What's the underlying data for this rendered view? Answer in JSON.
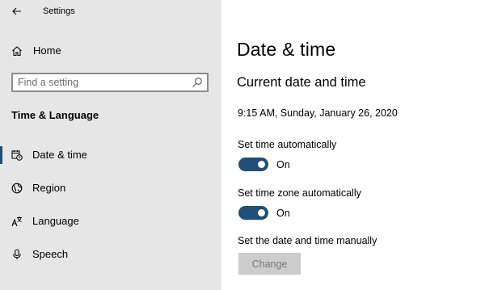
{
  "window": {
    "title": "Settings"
  },
  "sidebar": {
    "home_label": "Home",
    "search": {
      "placeholder": "Find a setting",
      "value": ""
    },
    "section_title": "Time & Language",
    "items": [
      {
        "label": "Date & time",
        "icon": "calendar-clock-icon",
        "selected": true
      },
      {
        "label": "Region",
        "icon": "globe-icon",
        "selected": false
      },
      {
        "label": "Language",
        "icon": "language-icon",
        "selected": false
      },
      {
        "label": "Speech",
        "icon": "microphone-icon",
        "selected": false
      }
    ]
  },
  "main": {
    "title": "Date & time",
    "section_heading": "Current date and time",
    "current_datetime": "9:15 AM, Sunday, January 26, 2020",
    "settings": {
      "set_time_auto": {
        "label": "Set time automatically",
        "state": "On",
        "on": true
      },
      "set_timezone_auto": {
        "label": "Set time zone automatically",
        "state": "On",
        "on": true
      },
      "manual": {
        "label": "Set the date and time manually",
        "button": "Change",
        "enabled": false
      }
    }
  },
  "colors": {
    "accent": "#1f4e78",
    "sidebar_bg": "#e6e6e6",
    "disabled_button_bg": "#cccccc",
    "disabled_button_text": "#7a7a7a"
  }
}
